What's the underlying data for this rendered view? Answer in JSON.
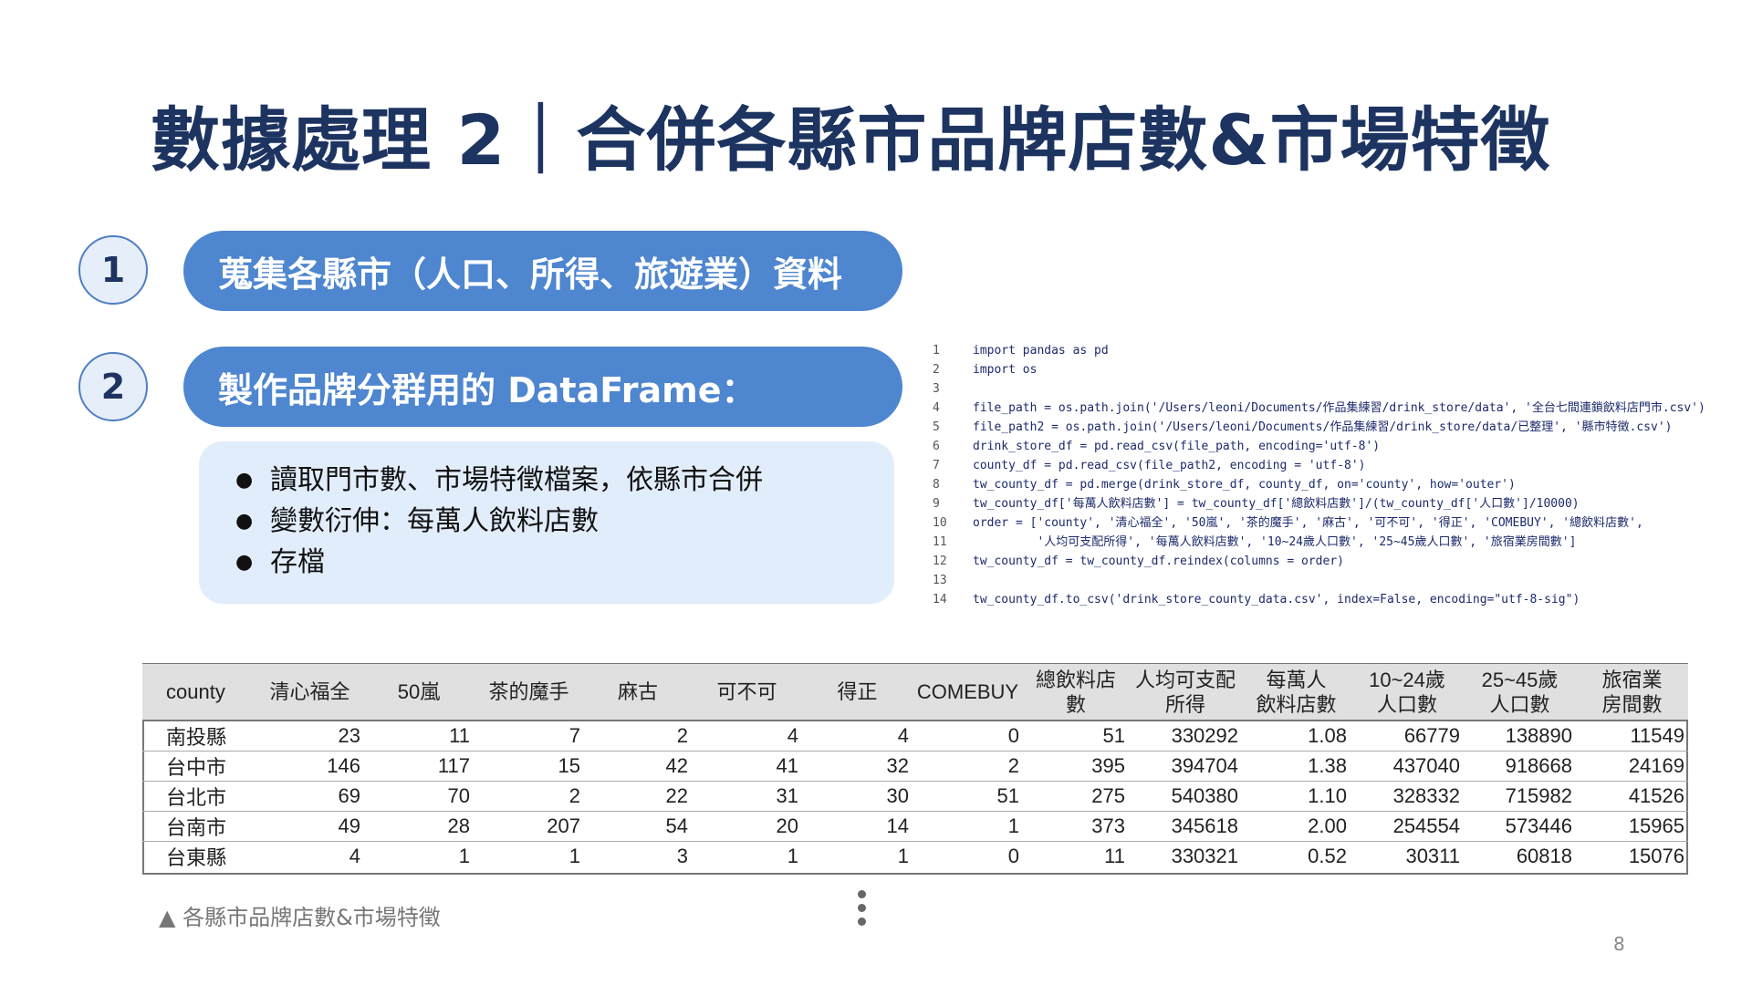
{
  "title": "數據處理 2｜合併各縣市品牌店數&市場特徵",
  "steps": [
    {
      "number": "1",
      "label": "蒐集各縣市（人口、所得、旅遊業）資料"
    },
    {
      "number": "2",
      "label": "製作品牌分群用的 DataFrame："
    }
  ],
  "bullets": [
    "讀取門市數、市場特徵檔案，依縣市合併",
    "變數衍伸：每萬人飲料店數",
    "存檔"
  ],
  "code_lines": [
    {
      "n": "1",
      "text": "import pandas as pd"
    },
    {
      "n": "2",
      "text": "import os"
    },
    {
      "n": "3",
      "text": ""
    },
    {
      "n": "4",
      "text": "file_path = os.path.join('/Users/leoni/Documents/作品集練習/drink_store/data', '全台七間連鎖飲料店門市.csv')"
    },
    {
      "n": "5",
      "text": "file_path2 = os.path.join('/Users/leoni/Documents/作品集練習/drink_store/data/已整理', '縣市特徵.csv')"
    },
    {
      "n": "6",
      "text": "drink_store_df = pd.read_csv(file_path, encoding='utf-8')"
    },
    {
      "n": "7",
      "text": "county_df = pd.read_csv(file_path2, encoding = 'utf-8')"
    },
    {
      "n": "8",
      "text": "tw_county_df = pd.merge(drink_store_df, county_df, on='county', how='outer')"
    },
    {
      "n": "9",
      "text": "tw_county_df['每萬人飲料店數'] = tw_county_df['總飲料店數']/(tw_county_df['人口數']/10000)"
    },
    {
      "n": "10",
      "text": "order = ['county', '清心福全', '50嵐', '茶的魔手', '麻古', '可不可', '得正', 'COMEBUY', '總飲料店數',"
    },
    {
      "n": "11",
      "text": "         '人均可支配所得', '每萬人飲料店數', '10~24歲人口數', '25~45歲人口數', '旅宿業房間數']"
    },
    {
      "n": "12",
      "text": "tw_county_df = tw_county_df.reindex(columns = order)"
    },
    {
      "n": "13",
      "text": ""
    },
    {
      "n": "14",
      "text": "tw_county_df.to_csv('drink_store_county_data.csv', index=False, encoding=\"utf-8-sig\")"
    }
  ],
  "table": {
    "headers": [
      "county",
      "清心福全",
      "50嵐",
      "茶的魔手",
      "麻古",
      "可不可",
      "得正",
      "COMEBUY",
      "總飲料店數",
      "人均可支配\n所得",
      "每萬人\n飲料店數",
      "10~24歲\n人口數",
      "25~45歲\n人口數",
      "旅宿業\n房間數"
    ],
    "rows": [
      [
        "南投縣",
        "23",
        "11",
        "7",
        "2",
        "4",
        "4",
        "0",
        "51",
        "330292",
        "1.08",
        "66779",
        "138890",
        "11549"
      ],
      [
        "台中市",
        "146",
        "117",
        "15",
        "42",
        "41",
        "32",
        "2",
        "395",
        "394704",
        "1.38",
        "437040",
        "918668",
        "24169"
      ],
      [
        "台北市",
        "69",
        "70",
        "2",
        "22",
        "31",
        "30",
        "51",
        "275",
        "540380",
        "1.10",
        "328332",
        "715982",
        "41526"
      ],
      [
        "台南市",
        "49",
        "28",
        "207",
        "54",
        "20",
        "14",
        "1",
        "373",
        "345618",
        "2.00",
        "254554",
        "573446",
        "15965"
      ],
      [
        "台東縣",
        "4",
        "1",
        "1",
        "3",
        "1",
        "1",
        "0",
        "11",
        "330321",
        "0.52",
        "30311",
        "60818",
        "15076"
      ]
    ]
  },
  "caption": "▲ 各縣市品牌店數&市場特徵",
  "page_number": "8",
  "colors": {
    "title": "#1d3461",
    "pill": "#4e86cf",
    "bullet_bg": "#e1edfb"
  }
}
